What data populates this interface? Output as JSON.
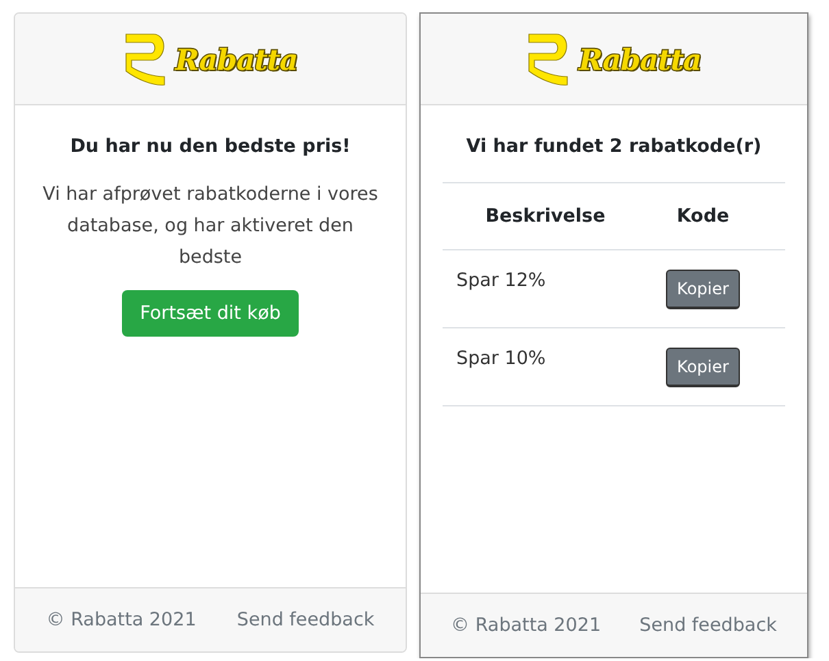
{
  "panels": [
    {
      "kind": "message",
      "logo": "Rabatta",
      "heading": "Du har nu den bedste pris!",
      "message": "Vi har afprøvet rabatkoderne i vores database, og har aktiveret den bedste",
      "button": "Fortsæt dit køb",
      "footer": {
        "copyright": "© Rabatta 2021",
        "feedback": "Send feedback"
      }
    },
    {
      "kind": "codes",
      "logo": "Rabatta",
      "heading": "Vi har fundet 2 rabatkode(r)",
      "columns": [
        "Beskrivelse",
        "Kode"
      ],
      "rows": [
        {
          "description": "Spar 12%",
          "button": "Kopier"
        },
        {
          "description": "Spar 10%",
          "button": "Kopier"
        }
      ],
      "footer": {
        "copyright": "© Rabatta 2021",
        "feedback": "Send feedback"
      }
    }
  ]
}
